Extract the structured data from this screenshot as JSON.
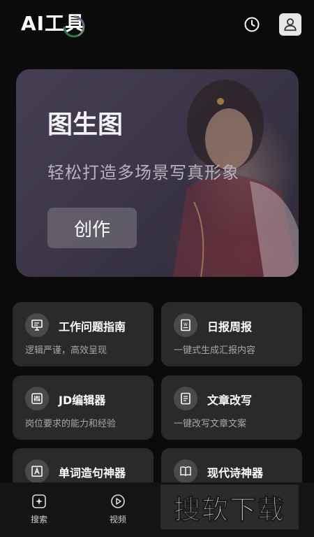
{
  "header": {
    "title": "AI工具",
    "history_icon": "clock-icon",
    "profile_icon": "user-icon"
  },
  "hero": {
    "title": "图生图",
    "subtitle": "轻松打造多场景写真形象",
    "button_label": "创作"
  },
  "tools": [
    {
      "title": "工作问题指南",
      "desc": "逻辑严谨，高效呈现",
      "icon": "presentation-icon"
    },
    {
      "title": "日报周报",
      "desc": "一键式生成汇报内容",
      "icon": "word-document-icon"
    },
    {
      "title": "JD编辑器",
      "desc": "岗位要求的能力和经验",
      "icon": "sliders-icon"
    },
    {
      "title": "文章改写",
      "desc": "一键改写文章文案",
      "icon": "document-icon"
    },
    {
      "title": "单词造句神器",
      "desc": "",
      "icon": "letter-a-icon"
    },
    {
      "title": "现代诗神器",
      "desc": "",
      "icon": "book-icon"
    }
  ],
  "bottom_nav": [
    {
      "label": "搜索",
      "icon": "search-sparkle-icon"
    },
    {
      "label": "视频",
      "icon": "play-icon"
    }
  ],
  "watermark": "搜软下载",
  "colors": {
    "background": "#0b0b0c",
    "card": "#2a2a2c",
    "hero_accent": "#463f54"
  }
}
